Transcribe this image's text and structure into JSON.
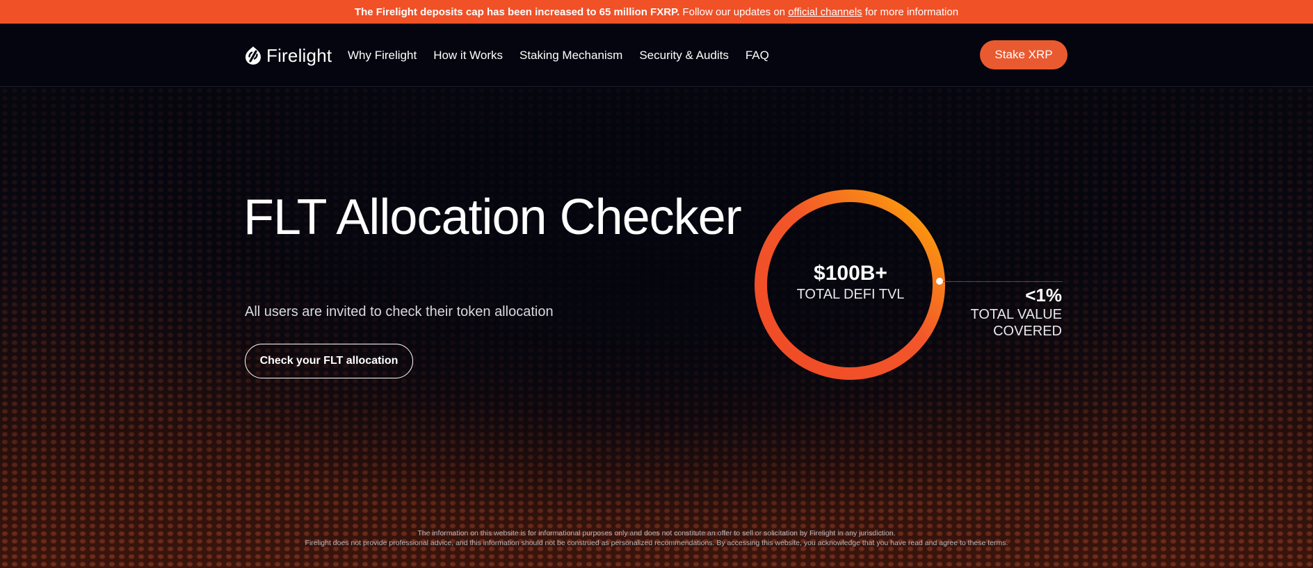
{
  "announcement": {
    "bold_text": "The Firelight deposits cap has been increased to 65 million FXRP.",
    "follow_text": " Follow our updates on ",
    "link_text": "official channels",
    "tail_text": " for more information"
  },
  "nav": {
    "logo_text": "Firelight",
    "logo_icon": "flame-icon",
    "links": [
      "Why Firelight",
      "How it Works",
      "Staking Mechanism",
      "Security & Audits",
      "FAQ"
    ],
    "cta_label": "Stake XRP"
  },
  "hero": {
    "title": "FLT Allocation Checker",
    "subtitle": "All users are invited to check their token allocation",
    "button_label": "Check your FLT allocation"
  },
  "stats": {
    "main_value": "$100B+",
    "main_label": "TOTAL DEFI TVL",
    "side_value": "<1%",
    "side_label_line1": "TOTAL VALUE",
    "side_label_line2": "COVERED"
  },
  "disclaimer": {
    "line1": "The information on this website is for informational purposes only and does not constitute an offer to sell or solicitation by Firelight in any jurisdiction.",
    "line2": "Firelight does not provide professional advice, and this information should not be construed as personalized recommendations. By accessing this website, you acknowledge that you have read and agree to these terms."
  },
  "colors": {
    "accent": "#f05127",
    "button": "#ea5a30",
    "ring_start": "#f04a26",
    "ring_end": "#ffb000",
    "background": "#05060f"
  }
}
